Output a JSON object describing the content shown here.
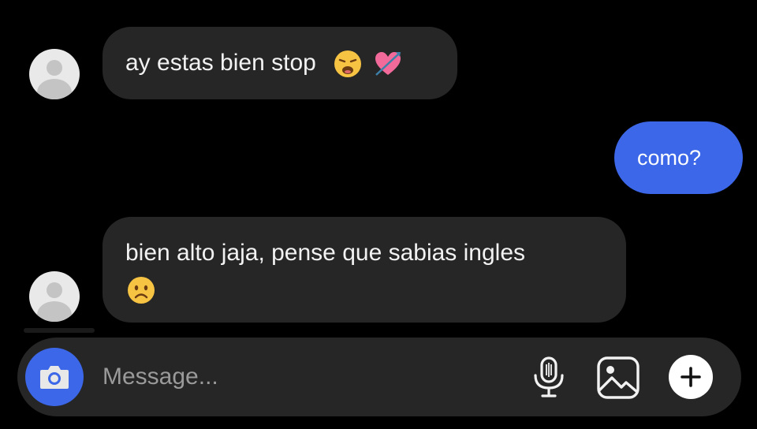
{
  "messages": [
    {
      "direction": "incoming",
      "text": "ay estas bien stop",
      "emojis": [
        "weary-face",
        "heart-with-arrow"
      ]
    },
    {
      "direction": "outgoing",
      "text": "como?"
    },
    {
      "direction": "incoming",
      "text": "bien alto jaja, pense que sabias ingles",
      "emojis": [
        "frowning-face"
      ]
    }
  ],
  "composer": {
    "placeholder": "Message...",
    "value": "",
    "buttons": [
      "camera-icon",
      "microphone-icon",
      "gallery-icon",
      "plus-icon"
    ]
  },
  "colors": {
    "background": "#000000",
    "incoming_bubble": "#262626",
    "outgoing_bubble": "#3b67e8",
    "accent": "#3b67e8",
    "text": "#f2f2f2",
    "placeholder": "#9a9a9a"
  }
}
